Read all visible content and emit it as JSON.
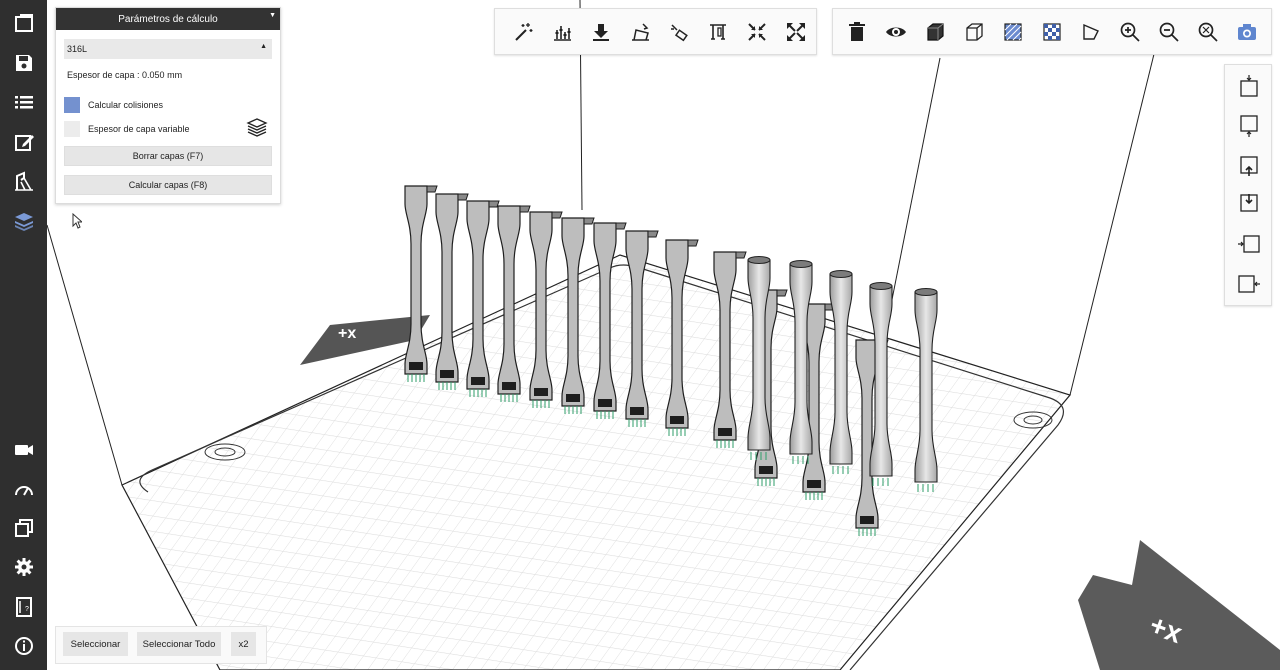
{
  "params_panel": {
    "title": "Parámetros de cálculo",
    "material": "316L",
    "layer_thickness": "Espesor de capa : 0.050 mm",
    "check_collisions": {
      "label": "Calcular colisiones",
      "checked": true
    },
    "variable_layer": {
      "label": "Espesor de capa variable",
      "checked": false
    },
    "clear_layers_button": "Borrar capas (F7)",
    "calc_layers_button": "Calcular capas (F8)"
  },
  "bottom_bar": {
    "select_label": "Seleccionar",
    "select_all_label": "Seleccionar Todo",
    "multiply_label": "x2"
  },
  "sidebar": {
    "top_items": [
      "new-project-icon",
      "save-icon",
      "list-icon",
      "edit-icon",
      "support-icon",
      "layers-icon"
    ],
    "bottom_items": [
      "camera-icon",
      "gauge-icon",
      "copy-icon",
      "settings-icon",
      "manual-icon",
      "info-icon"
    ]
  },
  "toolbar_main": [
    "magic-wand-icon",
    "histogram-icon",
    "drop-to-plate-icon",
    "orientation-icon",
    "rotate-icon",
    "support-gen-icon",
    "shrink-icon",
    "expand-icon"
  ],
  "toolbar_view": [
    "delete-icon",
    "eye-icon",
    "solid-cube-icon",
    "wire-cube-icon",
    "hatch-icon",
    "checker-icon",
    "flag-icon",
    "zoom-in-icon",
    "zoom-out-icon",
    "zoom-fit-icon",
    "screenshot-icon"
  ],
  "toolbar_camera": [
    "view-top-icon",
    "view-bottom-icon",
    "view-front-icon",
    "view-back-icon",
    "view-left-icon",
    "view-right-icon"
  ],
  "colors": {
    "sidebar": "#2f2f2f",
    "accent": "#7491cf",
    "part": "#bdbdbd",
    "grid": "#d9d9d9"
  }
}
